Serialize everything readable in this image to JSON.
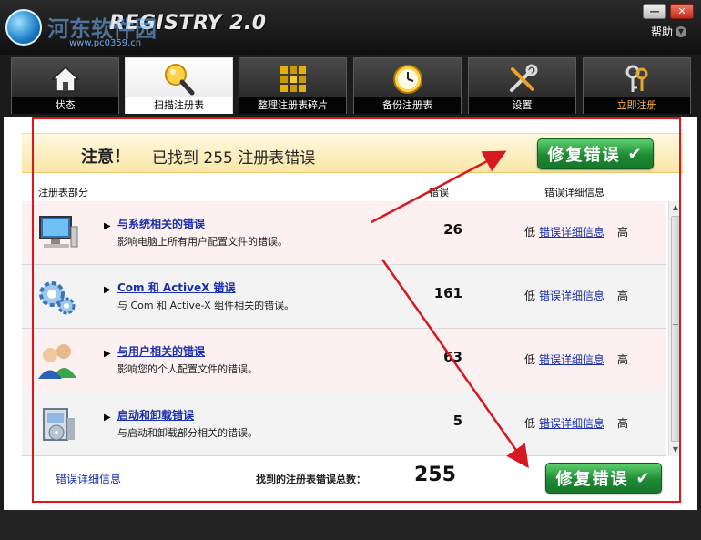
{
  "window": {
    "app_title": "REGISTRY 2.0",
    "watermark": "河东软件园",
    "watermark_url": "www.pc0359.cn",
    "minimize_glyph": "—",
    "close_glyph": "✕",
    "help_label": "帮助"
  },
  "tabs": [
    {
      "label": "状态",
      "icon": "house-icon"
    },
    {
      "label": "扫描注册表",
      "icon": "magnifier-icon",
      "active": true
    },
    {
      "label": "整理注册表碎片",
      "icon": "blocks-icon"
    },
    {
      "label": "备份注册表",
      "icon": "clock-icon"
    },
    {
      "label": "设置",
      "icon": "tools-icon"
    },
    {
      "label": "立即注册",
      "icon": "keys-icon"
    }
  ],
  "notice": {
    "label": "注意！",
    "text": "已找到  255 注册表错误",
    "fix_button": "修复错误"
  },
  "list_header": {
    "section": "注册表部分",
    "errors": "错误",
    "detail": "错误详细信息"
  },
  "rows": [
    {
      "title": "与系统相关的错误",
      "desc": "影响电脑上所有用户配置文件的错误。",
      "count": "26",
      "low": "低",
      "link": "错误详细信息",
      "high": "高",
      "icon": "computer-icon"
    },
    {
      "title": "Com  和  ActiveX  错误",
      "desc": "与  Com 和  Active-X 组件相关的错误。",
      "count": "161",
      "low": "低",
      "link": "错误详细信息",
      "high": "高",
      "icon": "gears-icon"
    },
    {
      "title": "与用户相关的错误",
      "desc": "影响您的个人配置文件的错误。",
      "count": "63",
      "low": "低",
      "link": "错误详细信息",
      "high": "高",
      "icon": "users-icon"
    },
    {
      "title": "启动和卸载错误",
      "desc": "与启动和卸载部分相关的错误。",
      "count": "5",
      "low": "低",
      "link": "错误详细信息",
      "high": "高",
      "icon": "installer-icon"
    }
  ],
  "footer": {
    "link": "错误详细信息",
    "total_label": "找到的注册表错误总数：",
    "total": "255",
    "fix_button": "修复错误"
  },
  "check_glyph": "✔",
  "colors": {
    "accent_green": "#1e8b34",
    "link_blue": "#1a2fb0",
    "annotation_red": "#e0141b",
    "register_orange": "#ffb347"
  }
}
